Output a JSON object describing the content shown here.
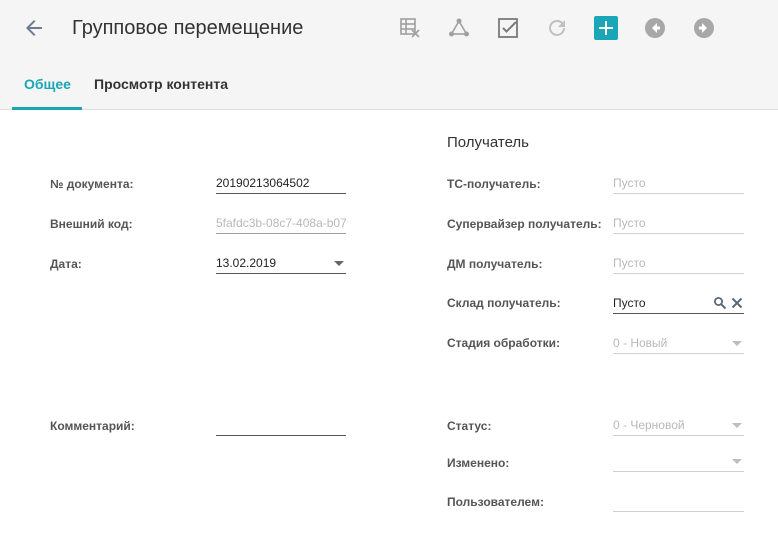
{
  "header": {
    "title": "Групповое перемещение",
    "icons": [
      "back-arrow-icon",
      "table-delete-icon",
      "hierarchy-icon",
      "checkbox-icon",
      "refresh-icon",
      "add-icon",
      "prev-circle-icon",
      "next-circle-icon"
    ]
  },
  "tabs": [
    {
      "label": "Общее",
      "active": true
    },
    {
      "label": "Просмотр контента",
      "active": false
    }
  ],
  "left": {
    "doc_number": {
      "label": "№ документа:",
      "value": "20190213064502"
    },
    "external_code": {
      "label": "Внешний код:",
      "value": "5fafdc3b-08c7-408a-b07"
    },
    "date": {
      "label": "Дата:",
      "value": "13.02.2019"
    },
    "comment": {
      "label": "Комментарий:",
      "value": ""
    }
  },
  "right": {
    "section_title": "Получатель",
    "ts_receiver": {
      "label": "ТС-получатель:",
      "placeholder": "Пусто"
    },
    "supervisor_receiver": {
      "label": "Супервайзер получатель:",
      "placeholder": "Пусто"
    },
    "dm_receiver": {
      "label": "ДМ получатель:",
      "placeholder": "Пусто"
    },
    "warehouse_receiver": {
      "label": "Склад получатель:",
      "value": "Пусто"
    },
    "processing_stage": {
      "label": "Стадия обработки:",
      "value": "0 - Новый"
    },
    "status": {
      "label": "Статус:",
      "value": "0 - Черновой"
    },
    "changed": {
      "label": "Изменено:",
      "value": ""
    },
    "by_user": {
      "label": "Пользователем:",
      "value": ""
    }
  },
  "colors": {
    "accent": "#1aa6b7",
    "topbar": "#f5f5f5",
    "icon_gray": "#9e9e9e"
  }
}
